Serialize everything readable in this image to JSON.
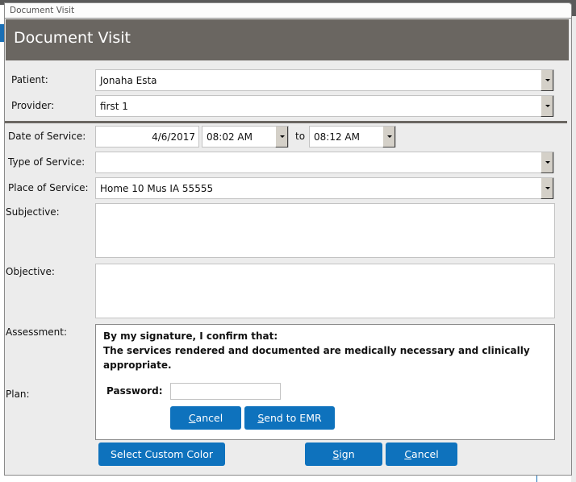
{
  "window": {
    "titlebar": "Document Visit",
    "header_title": "Document Visit"
  },
  "form": {
    "patient": {
      "label": "Patient:",
      "value": "Jonaha Esta"
    },
    "provider": {
      "label": "Provider:",
      "value": "first 1"
    },
    "date_of_service": {
      "label": "Date of Service:",
      "date": "4/6/2017",
      "start_time": "08:02 AM",
      "to_label": "to",
      "end_time": "08:12 AM"
    },
    "type_of_service": {
      "label": "Type of Service:",
      "value": ""
    },
    "place_of_service": {
      "label": "Place of Service:",
      "value": "Home 10  Mus IA 55555"
    },
    "subjective": {
      "label": "Subjective:",
      "value": ""
    },
    "objective": {
      "label": "Objective:",
      "value": ""
    },
    "assessment": {
      "label": "Assessment:"
    },
    "plan": {
      "label": "Plan:"
    }
  },
  "signature_panel": {
    "line1": "By my signature, I confirm that:",
    "line2": "The services rendered and documented are medically necessary and clinically",
    "line3": "appropriate.",
    "password_label": "Password:",
    "password_value": "",
    "cancel_label_access": "C",
    "cancel_label_rest": "ancel",
    "send_label_access": "S",
    "send_label_rest": "end to EMR"
  },
  "footer": {
    "custom_color_label": "Select Custom Color",
    "sign_access": "S",
    "sign_rest": "ign",
    "cancel_access": "C",
    "cancel_rest": "ancel"
  },
  "colors": {
    "header": "#6a6661",
    "button": "#0e72bd",
    "background": "#ececec"
  }
}
